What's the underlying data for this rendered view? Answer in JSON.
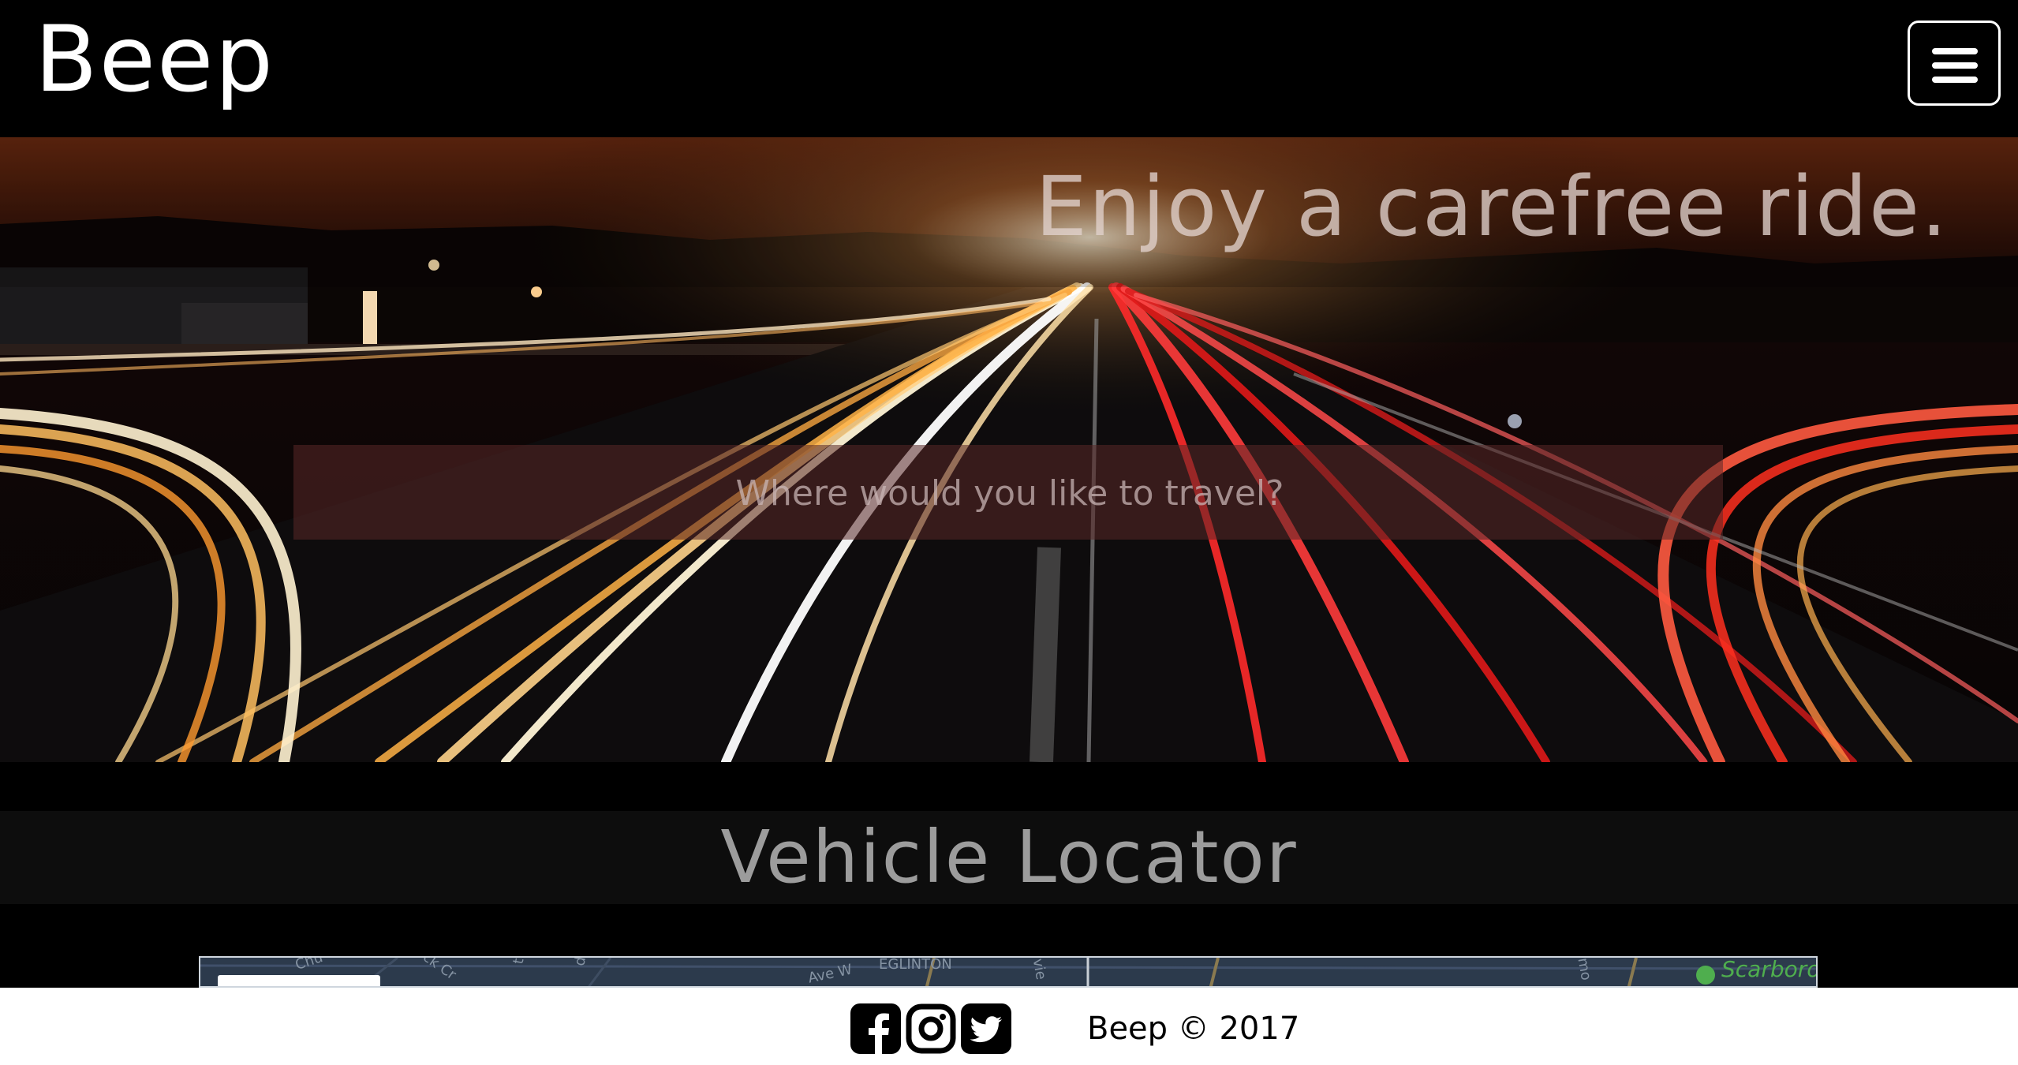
{
  "header": {
    "brand": "Beep",
    "menu_icon": "hamburger-menu-icon"
  },
  "hero": {
    "title": "Enjoy a carefree ride.",
    "search_placeholder": "Where would you like to travel?"
  },
  "locator": {
    "title": "Vehicle Locator"
  },
  "map": {
    "labels": [
      "Chu",
      "ck Cr",
      "t",
      "d",
      "Ave W",
      "EGLINTON",
      "vie",
      "mo"
    ],
    "park_label": "Scarborou"
  },
  "footer": {
    "social": [
      "facebook-icon",
      "instagram-icon",
      "twitter-icon"
    ],
    "copyright": "Beep © 2017"
  }
}
